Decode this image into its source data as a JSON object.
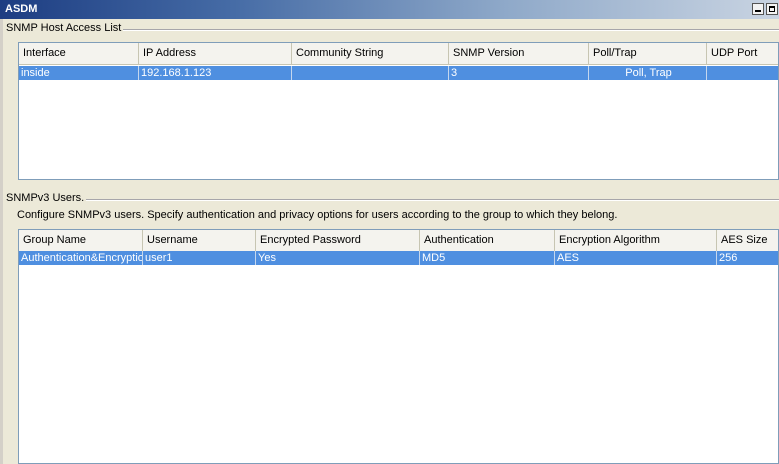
{
  "window": {
    "title": "ASDM"
  },
  "host_access": {
    "section_label": "SNMP Host Access List",
    "columns": [
      "Interface",
      "IP Address",
      "Community String",
      "SNMP Version",
      "Poll/Trap",
      "UDP Port"
    ],
    "rows": [
      {
        "interface": "inside",
        "ip_address": "192.168.1.123",
        "community_string": "",
        "snmp_version": "3",
        "poll_trap": "Poll, Trap",
        "udp_port": ""
      }
    ]
  },
  "v3_users": {
    "section_label": "SNMPv3 Users.",
    "description": "Configure SNMPv3 users. Specify authentication and privacy options for users according to the group to which they belong.",
    "columns": [
      "Group Name",
      "Username",
      "Encrypted Password",
      "Authentication",
      "Encryption Algorithm",
      "AES Size"
    ],
    "rows": [
      {
        "group_name": "Authentication&Encryption",
        "username": "user1",
        "encrypted_password": "Yes",
        "authentication": "MD5",
        "encryption_algorithm": "AES",
        "aes_size": "256"
      }
    ]
  }
}
